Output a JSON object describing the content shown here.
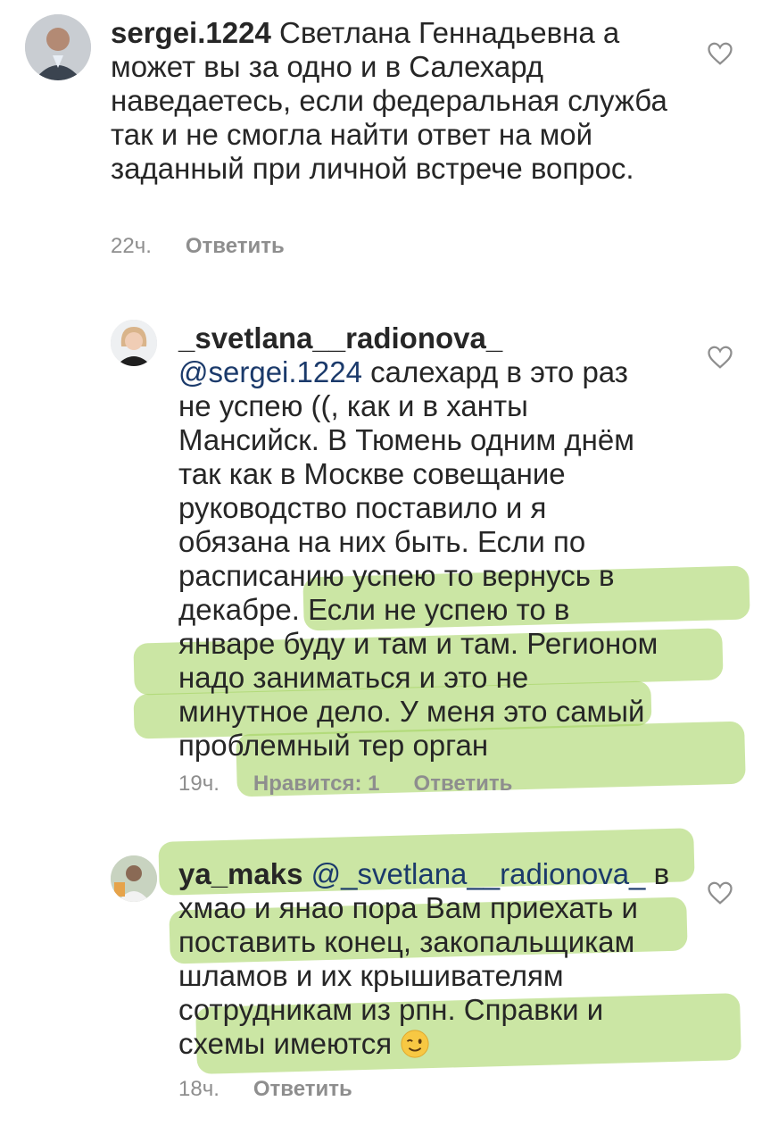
{
  "comments": [
    {
      "username": "sergei.1224",
      "text": "Светлана Геннадьевна а может вы за одно и в Салехард наведаетесь, если федеральная служба так и не смогла найти ответ на мой заданный при личной встрече вопрос.",
      "time": "22ч.",
      "reply_label": "Ответить"
    },
    {
      "username": "_svetlana__radionova_",
      "mention": "@sergei.1224",
      "text": "салехард в это раз не успею ((, как и в ханты Мансийск. В Тюмень одним днём так как в Москве совещание руководство поставило и я обязана на них быть. Если по расписанию успею то вернусь в декабре. Если не успею то в январе буду и там и там. Регионом надо заниматься и это не минутное дело. У меня это самый проблемный тер орган",
      "time": "19ч.",
      "likes_label": "Нравится: 1",
      "reply_label": "Ответить"
    },
    {
      "username": "ya_maks",
      "mention": "@_svetlana__radionova_",
      "text": "в хмао и янао пора Вам приехать и поставить конец, закопальщикам шламов  и их крышивателям сотрудникам из рпн. Справки и схемы имеются",
      "emoji": "winking-face",
      "time": "18ч.",
      "reply_label": "Ответить"
    }
  ],
  "colors": {
    "highlight": "#a0d25a",
    "mention": "#1b3a6b",
    "meta": "#8e8e8e"
  }
}
